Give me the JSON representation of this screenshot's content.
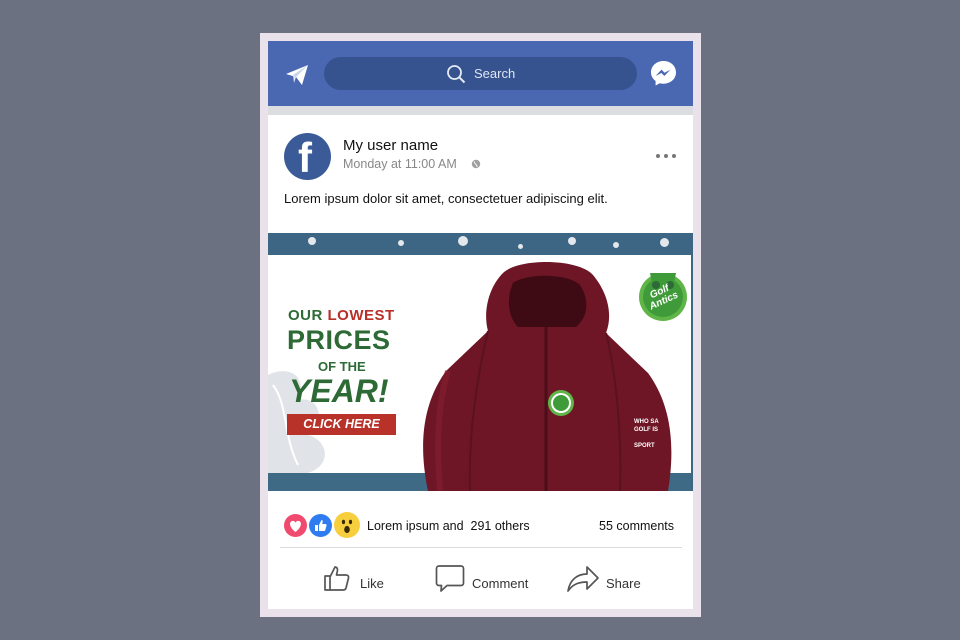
{
  "header": {
    "search_label": "Search"
  },
  "post": {
    "user_name": "My user name",
    "timestamp": "Monday at 11:00 AM",
    "text": "Lorem ipsum dolor sit amet, consectetuer adipiscing elit."
  },
  "ad": {
    "line1_prefix": "OUR ",
    "line1_accent": "LOWEST",
    "line2": "PRICES",
    "line3": "OF THE",
    "line4": "YEAR!",
    "cta": "CLICK HERE",
    "logo_text": "Golf Antics",
    "colors": {
      "green": "#2d6a35",
      "red": "#b9302a",
      "jacket": "#6e1626",
      "frost": "#3c6683"
    }
  },
  "reactions": {
    "icons": [
      "heart-icon",
      "thumbs-up-icon",
      "wow-icon"
    ],
    "summary_name": "Lorem ipsum and",
    "summary_others": "291 others",
    "comments": "55 comments"
  },
  "actions": {
    "like": "Like",
    "comment": "Comment",
    "share": "Share"
  },
  "colors": {
    "header_blue": "#4a68b2",
    "search_bg": "#36538f",
    "avatar_blue": "#3b5b98"
  }
}
